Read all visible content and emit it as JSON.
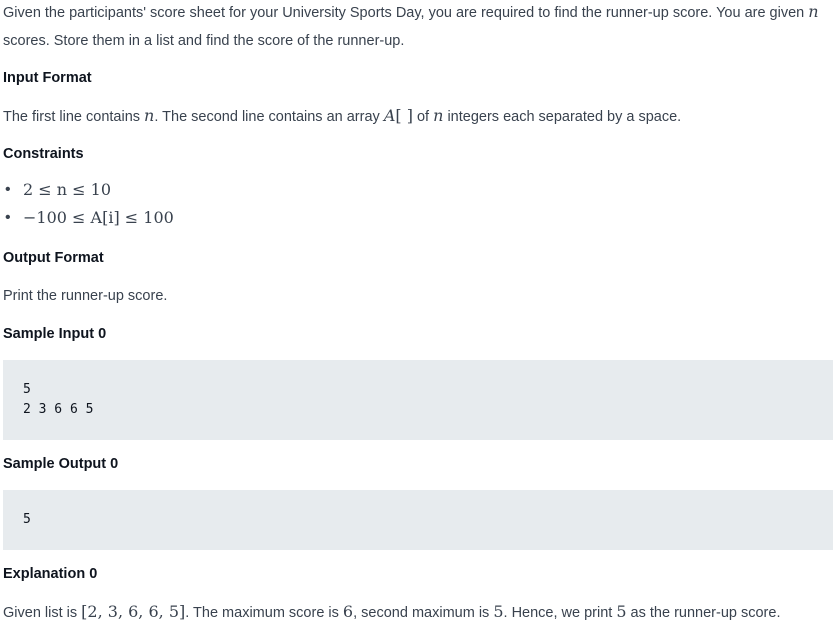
{
  "intro": {
    "part1": "Given the participants' score sheet for your University Sports Day, you are required to find the runner-up score. You are given ",
    "var_n": "n",
    "part2": "scores. Store them in a list and find the score of the runner-up."
  },
  "input_format": {
    "heading": "Input Format",
    "part1": "The first line contains ",
    "var_n1": "n",
    "part2": ". The second line contains an array ",
    "var_A": "A",
    "brackets": "[ ]",
    "part3": " of ",
    "var_n2": "n",
    "part4": " integers each separated by a space."
  },
  "constraints": {
    "heading": "Constraints",
    "items": [
      "2 ≤ n ≤ 10",
      "−100 ≤ A[i] ≤ 100"
    ]
  },
  "output_format": {
    "heading": "Output Format",
    "text": "Print the runner-up score."
  },
  "sample_input": {
    "heading": "Sample Input 0",
    "lines": [
      "5",
      "2 3 6 6 5"
    ]
  },
  "sample_output": {
    "heading": "Sample Output 0",
    "lines": [
      "5"
    ]
  },
  "explanation": {
    "heading": "Explanation 0",
    "part1": "Given list is ",
    "list": "[2, 3, 6, 6, 5]",
    "part2": ". The maximum score is ",
    "max": "6",
    "part3": ", second maximum is ",
    "second": "5",
    "part4": ". Hence, we print ",
    "answer": "5",
    "part5": " as the runner-up score."
  }
}
